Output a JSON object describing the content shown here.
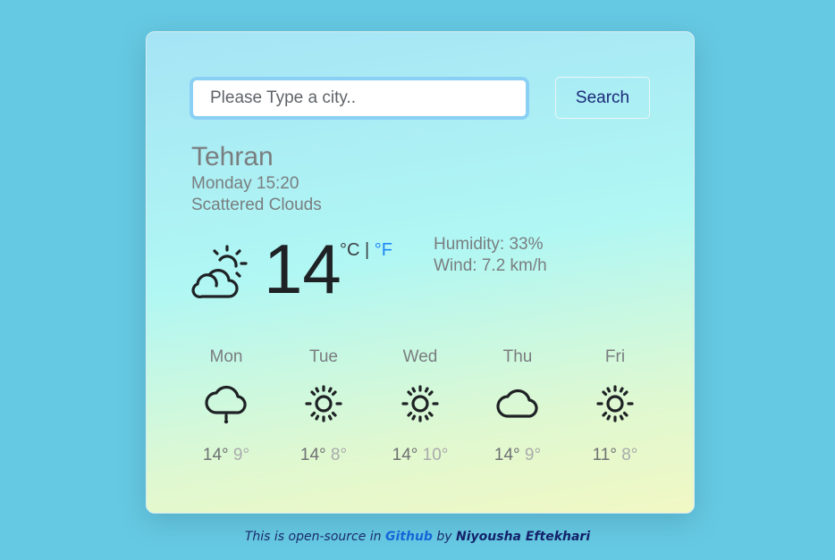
{
  "search": {
    "placeholder": "Please Type a city..",
    "value": "",
    "button_label": "Search"
  },
  "current": {
    "city": "Tehran",
    "datetime": "Monday 15:20",
    "description": "Scattered Clouds",
    "icon": "partly-cloudy-day-icon",
    "temperature": "14",
    "unit_celsius": "°C",
    "unit_separator": " | ",
    "unit_fahrenheit": "°F",
    "humidity": "Humidity: 33%",
    "wind": "Wind: 7.2 km/h"
  },
  "forecast": [
    {
      "day": "Mon",
      "icon": "cloud-rain-icon",
      "max": "14°",
      "min": "9°"
    },
    {
      "day": "Tue",
      "icon": "sun-icon",
      "max": "14°",
      "min": "8°"
    },
    {
      "day": "Wed",
      "icon": "sun-icon",
      "max": "14°",
      "min": "10°"
    },
    {
      "day": "Thu",
      "icon": "cloud-icon",
      "max": "14°",
      "min": "9°"
    },
    {
      "day": "Fri",
      "icon": "sun-icon",
      "max": "11°",
      "min": "8°"
    }
  ],
  "footer": {
    "prefix": "This is open-source in ",
    "github_label": "Github",
    "middle": " by ",
    "author": "Niyousha Eftekhari"
  },
  "colors": {
    "background": "#66c9e3",
    "accent_link": "#1e88f5",
    "search_text": "#1a2a7a"
  }
}
